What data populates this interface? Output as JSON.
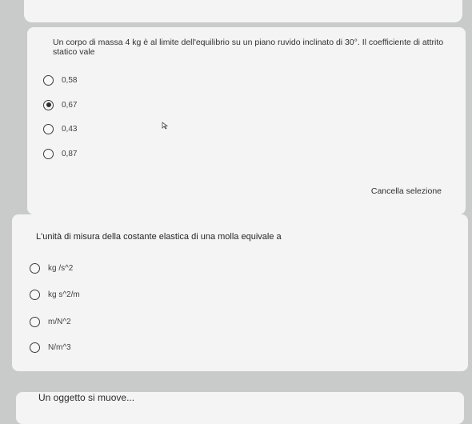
{
  "question_1": {
    "text": "Un corpo di massa 4 kg è al limite dell'equilibrio su un piano ruvido inclinato di 30°. Il coefficiente di attrito statico vale",
    "options": [
      "0,58",
      "0,67",
      "0,43",
      "0,87"
    ],
    "selected_option": "0,67",
    "clear_label": "Cancella selezione"
  },
  "question_2": {
    "text": "L'unità di misura della costante elastica di una molla equivale a",
    "options": [
      "kg /s^2",
      "kg  s^2/m",
      "m/N^2",
      "N/m^3"
    ]
  },
  "question_3": {
    "text": "Un oggetto si muove..."
  },
  "icons": {
    "cursor": "arrow-cursor-icon"
  }
}
